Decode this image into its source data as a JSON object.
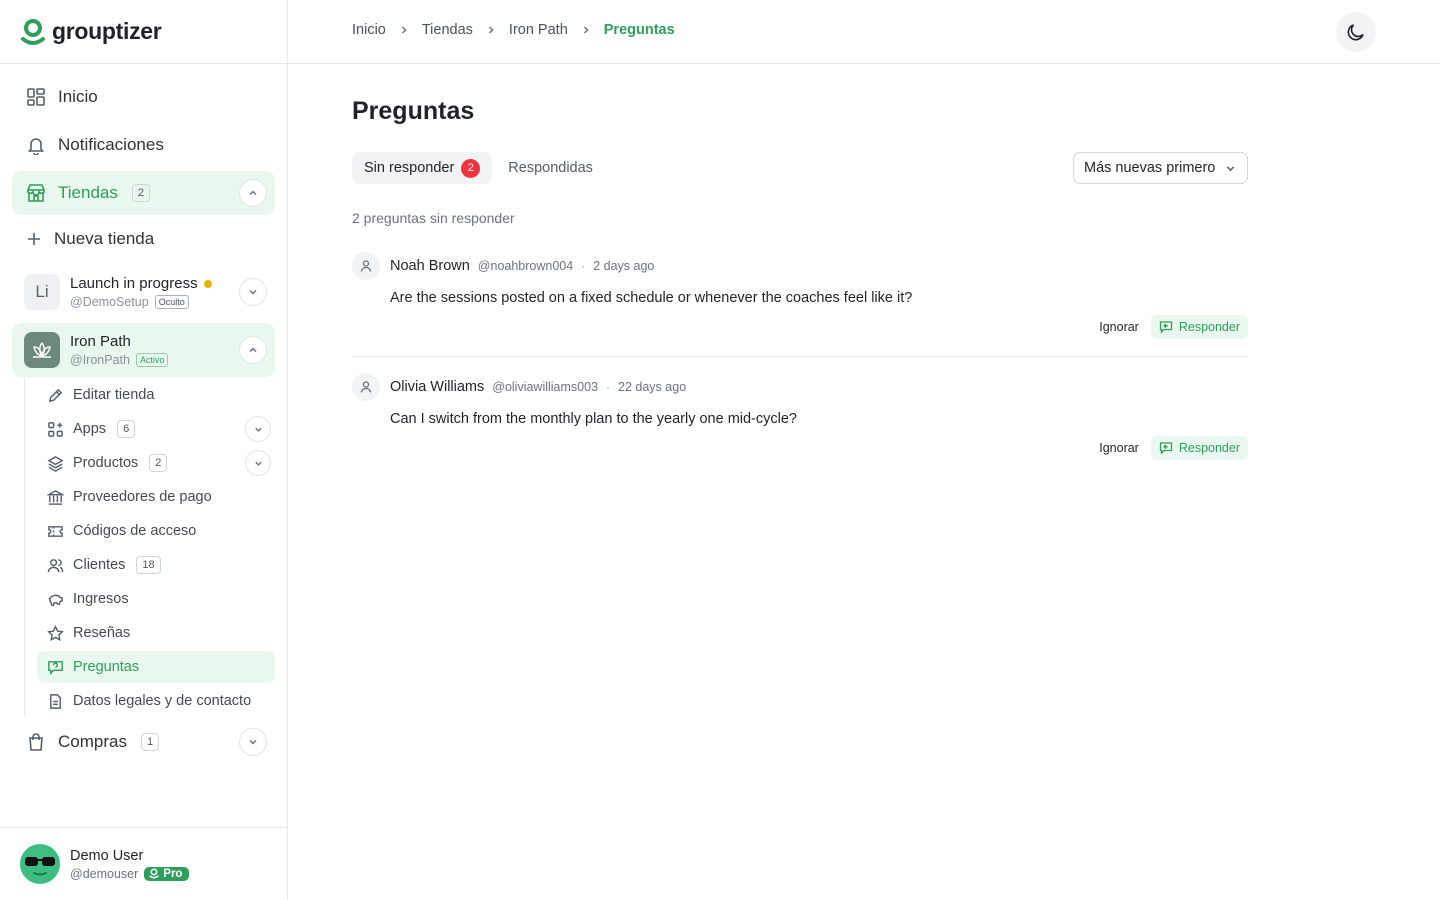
{
  "brand": {
    "name": "grouptizer",
    "accent": "#2e9e5b",
    "danger": "#ef3340"
  },
  "sidebar": {
    "nav": [
      {
        "label": "Inicio",
        "icon": "dashboard-icon"
      },
      {
        "label": "Notificaciones",
        "icon": "bell-icon"
      },
      {
        "label": "Tiendas",
        "icon": "store-icon",
        "count": "2"
      },
      {
        "label": "Nueva tienda",
        "icon": "plus-icon"
      }
    ],
    "stores": [
      {
        "initials": "Li",
        "name": "Launch in progress",
        "handle": "@DemoSetup",
        "tag": "Oculto"
      },
      {
        "name": "Iron Path",
        "handle": "@IronPath",
        "tag": "Activo"
      }
    ],
    "store_menu": [
      {
        "label": "Editar tienda",
        "icon": "pencil-icon"
      },
      {
        "label": "Apps",
        "icon": "apps-icon",
        "count": "6"
      },
      {
        "label": "Productos",
        "icon": "layers-icon",
        "count": "2"
      },
      {
        "label": "Proveedores de pago",
        "icon": "bank-icon"
      },
      {
        "label": "Códigos de acceso",
        "icon": "ticket-icon"
      },
      {
        "label": "Clientes",
        "icon": "users-icon",
        "count": "18"
      },
      {
        "label": "Ingresos",
        "icon": "piggy-bank-icon"
      },
      {
        "label": "Reseñas",
        "icon": "star-icon"
      },
      {
        "label": "Preguntas",
        "icon": "message-question-icon"
      },
      {
        "label": "Datos legales y de contacto",
        "icon": "document-icon"
      }
    ],
    "purchases": {
      "label": "Compras",
      "count": "1"
    },
    "user": {
      "name": "Demo User",
      "handle": "@demouser",
      "plan": "Pro"
    }
  },
  "header": {
    "breadcrumb": [
      "Inicio",
      "Tiendas",
      "Iron Path",
      "Preguntas"
    ]
  },
  "main": {
    "title": "Preguntas",
    "tabs": [
      {
        "label": "Sin responder",
        "count": "2"
      },
      {
        "label": "Respondidas"
      }
    ],
    "sort": "Más nuevas primero",
    "count_text": "2 preguntas sin responder",
    "ignore_label": "Ignorar",
    "reply_label": "Responder",
    "questions": [
      {
        "name": "Noah Brown",
        "handle": "@noahbrown004",
        "date": "2 days ago",
        "text": "Are the sessions posted on a fixed schedule or whenever the coaches feel like it?"
      },
      {
        "name": "Olivia Williams",
        "handle": "@oliviawilliams003",
        "date": "22 days ago",
        "text": "Can I switch from the monthly plan to the yearly one mid-cycle?"
      }
    ]
  }
}
